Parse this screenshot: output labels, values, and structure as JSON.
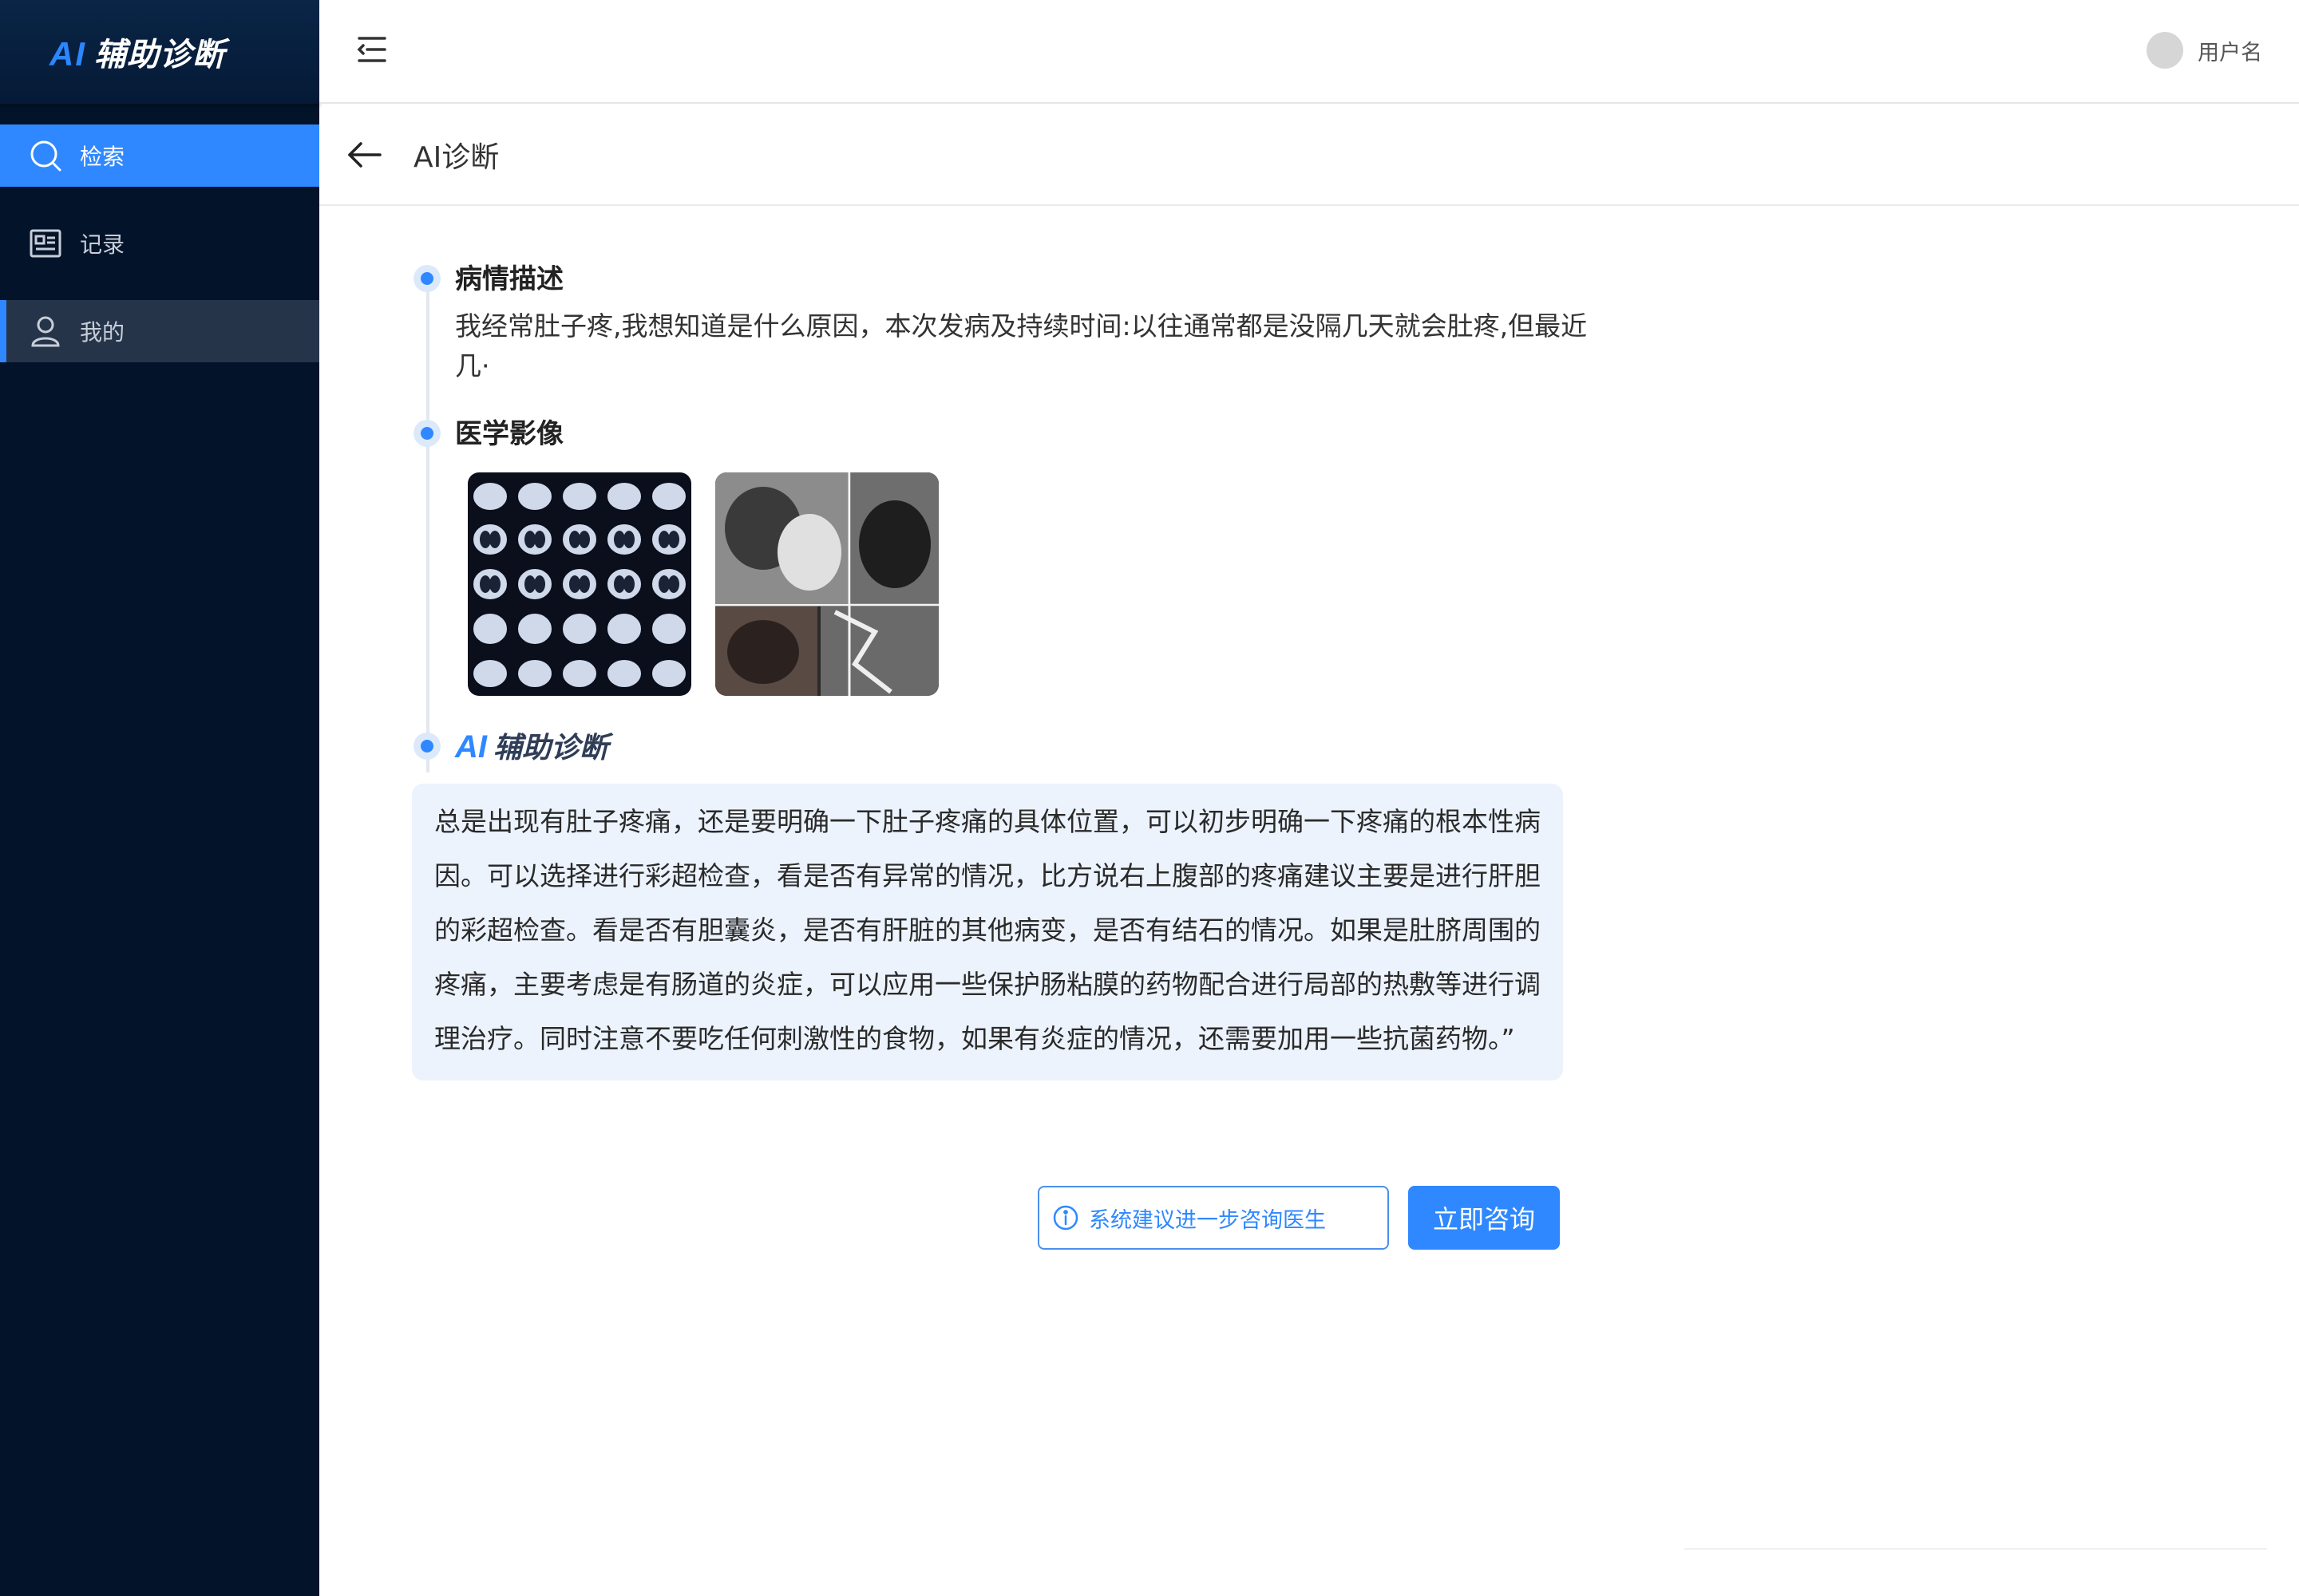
{
  "brand": {
    "ai": "AI",
    "text": "辅助诊断"
  },
  "sidebar": {
    "items": [
      {
        "label": "检索",
        "icon": "search-icon"
      },
      {
        "label": "记录",
        "icon": "record-icon"
      },
      {
        "label": "我的",
        "icon": "user-icon"
      }
    ]
  },
  "header": {
    "username": "用户名"
  },
  "page": {
    "title": "AI诊断"
  },
  "sections": {
    "description": {
      "title": "病情描述",
      "text": "我经常肚子疼,我想知道是什么原因，本次发病及持续时间:以往通常都是没隔几天就会肚疼,但最近几·"
    },
    "images": {
      "title": "医学影像"
    },
    "ai": {
      "title_ai": "AI",
      "title_text": "辅助诊断",
      "answer": "总是出现有肚子疼痛，还是要明确一下肚子疼痛的具体位置，可以初步明确一下疼痛的根本性病因。可以选择进行彩超检查，看是否有异常的情况，比方说右上腹部的疼痛建议主要是进行肝胆的彩超检查。看是否有胆囊炎，是否有肝脏的其他病变，是否有结石的情况。如果是肚脐周围的疼痛，主要考虑是有肠道的炎症，可以应用一些保护肠粘膜的药物配合进行局部的热敷等进行调理治疗。同时注意不要吃任何刺激性的食物，如果有炎症的情况，还需要加用一些抗菌药物。”"
    }
  },
  "actions": {
    "hint": "系统建议进一步咨询医生",
    "consult": "立即咨询"
  },
  "colors": {
    "accent": "#2f88ff",
    "sidebar_bg": "#03132a",
    "answer_bg": "#ecf3fd"
  }
}
